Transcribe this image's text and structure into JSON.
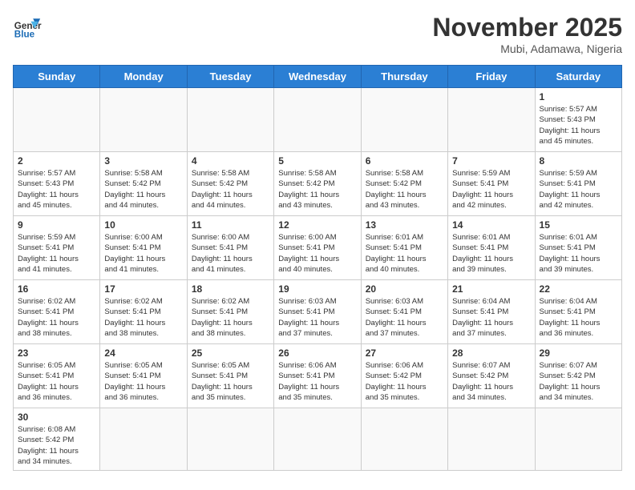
{
  "header": {
    "logo_general": "General",
    "logo_blue": "Blue",
    "title": "November 2025",
    "subtitle": "Mubi, Adamawa, Nigeria"
  },
  "weekdays": [
    "Sunday",
    "Monday",
    "Tuesday",
    "Wednesday",
    "Thursday",
    "Friday",
    "Saturday"
  ],
  "weeks": [
    [
      {
        "day": "",
        "info": ""
      },
      {
        "day": "",
        "info": ""
      },
      {
        "day": "",
        "info": ""
      },
      {
        "day": "",
        "info": ""
      },
      {
        "day": "",
        "info": ""
      },
      {
        "day": "",
        "info": ""
      },
      {
        "day": "1",
        "info": "Sunrise: 5:57 AM\nSunset: 5:43 PM\nDaylight: 11 hours\nand 45 minutes."
      }
    ],
    [
      {
        "day": "2",
        "info": "Sunrise: 5:57 AM\nSunset: 5:43 PM\nDaylight: 11 hours\nand 45 minutes."
      },
      {
        "day": "3",
        "info": "Sunrise: 5:58 AM\nSunset: 5:42 PM\nDaylight: 11 hours\nand 44 minutes."
      },
      {
        "day": "4",
        "info": "Sunrise: 5:58 AM\nSunset: 5:42 PM\nDaylight: 11 hours\nand 44 minutes."
      },
      {
        "day": "5",
        "info": "Sunrise: 5:58 AM\nSunset: 5:42 PM\nDaylight: 11 hours\nand 43 minutes."
      },
      {
        "day": "6",
        "info": "Sunrise: 5:58 AM\nSunset: 5:42 PM\nDaylight: 11 hours\nand 43 minutes."
      },
      {
        "day": "7",
        "info": "Sunrise: 5:59 AM\nSunset: 5:41 PM\nDaylight: 11 hours\nand 42 minutes."
      },
      {
        "day": "8",
        "info": "Sunrise: 5:59 AM\nSunset: 5:41 PM\nDaylight: 11 hours\nand 42 minutes."
      }
    ],
    [
      {
        "day": "9",
        "info": "Sunrise: 5:59 AM\nSunset: 5:41 PM\nDaylight: 11 hours\nand 41 minutes."
      },
      {
        "day": "10",
        "info": "Sunrise: 6:00 AM\nSunset: 5:41 PM\nDaylight: 11 hours\nand 41 minutes."
      },
      {
        "day": "11",
        "info": "Sunrise: 6:00 AM\nSunset: 5:41 PM\nDaylight: 11 hours\nand 41 minutes."
      },
      {
        "day": "12",
        "info": "Sunrise: 6:00 AM\nSunset: 5:41 PM\nDaylight: 11 hours\nand 40 minutes."
      },
      {
        "day": "13",
        "info": "Sunrise: 6:01 AM\nSunset: 5:41 PM\nDaylight: 11 hours\nand 40 minutes."
      },
      {
        "day": "14",
        "info": "Sunrise: 6:01 AM\nSunset: 5:41 PM\nDaylight: 11 hours\nand 39 minutes."
      },
      {
        "day": "15",
        "info": "Sunrise: 6:01 AM\nSunset: 5:41 PM\nDaylight: 11 hours\nand 39 minutes."
      }
    ],
    [
      {
        "day": "16",
        "info": "Sunrise: 6:02 AM\nSunset: 5:41 PM\nDaylight: 11 hours\nand 38 minutes."
      },
      {
        "day": "17",
        "info": "Sunrise: 6:02 AM\nSunset: 5:41 PM\nDaylight: 11 hours\nand 38 minutes."
      },
      {
        "day": "18",
        "info": "Sunrise: 6:02 AM\nSunset: 5:41 PM\nDaylight: 11 hours\nand 38 minutes."
      },
      {
        "day": "19",
        "info": "Sunrise: 6:03 AM\nSunset: 5:41 PM\nDaylight: 11 hours\nand 37 minutes."
      },
      {
        "day": "20",
        "info": "Sunrise: 6:03 AM\nSunset: 5:41 PM\nDaylight: 11 hours\nand 37 minutes."
      },
      {
        "day": "21",
        "info": "Sunrise: 6:04 AM\nSunset: 5:41 PM\nDaylight: 11 hours\nand 37 minutes."
      },
      {
        "day": "22",
        "info": "Sunrise: 6:04 AM\nSunset: 5:41 PM\nDaylight: 11 hours\nand 36 minutes."
      }
    ],
    [
      {
        "day": "23",
        "info": "Sunrise: 6:05 AM\nSunset: 5:41 PM\nDaylight: 11 hours\nand 36 minutes."
      },
      {
        "day": "24",
        "info": "Sunrise: 6:05 AM\nSunset: 5:41 PM\nDaylight: 11 hours\nand 36 minutes."
      },
      {
        "day": "25",
        "info": "Sunrise: 6:05 AM\nSunset: 5:41 PM\nDaylight: 11 hours\nand 35 minutes."
      },
      {
        "day": "26",
        "info": "Sunrise: 6:06 AM\nSunset: 5:41 PM\nDaylight: 11 hours\nand 35 minutes."
      },
      {
        "day": "27",
        "info": "Sunrise: 6:06 AM\nSunset: 5:42 PM\nDaylight: 11 hours\nand 35 minutes."
      },
      {
        "day": "28",
        "info": "Sunrise: 6:07 AM\nSunset: 5:42 PM\nDaylight: 11 hours\nand 34 minutes."
      },
      {
        "day": "29",
        "info": "Sunrise: 6:07 AM\nSunset: 5:42 PM\nDaylight: 11 hours\nand 34 minutes."
      }
    ],
    [
      {
        "day": "30",
        "info": "Sunrise: 6:08 AM\nSunset: 5:42 PM\nDaylight: 11 hours\nand 34 minutes."
      },
      {
        "day": "",
        "info": ""
      },
      {
        "day": "",
        "info": ""
      },
      {
        "day": "",
        "info": ""
      },
      {
        "day": "",
        "info": ""
      },
      {
        "day": "",
        "info": ""
      },
      {
        "day": "",
        "info": ""
      }
    ]
  ]
}
